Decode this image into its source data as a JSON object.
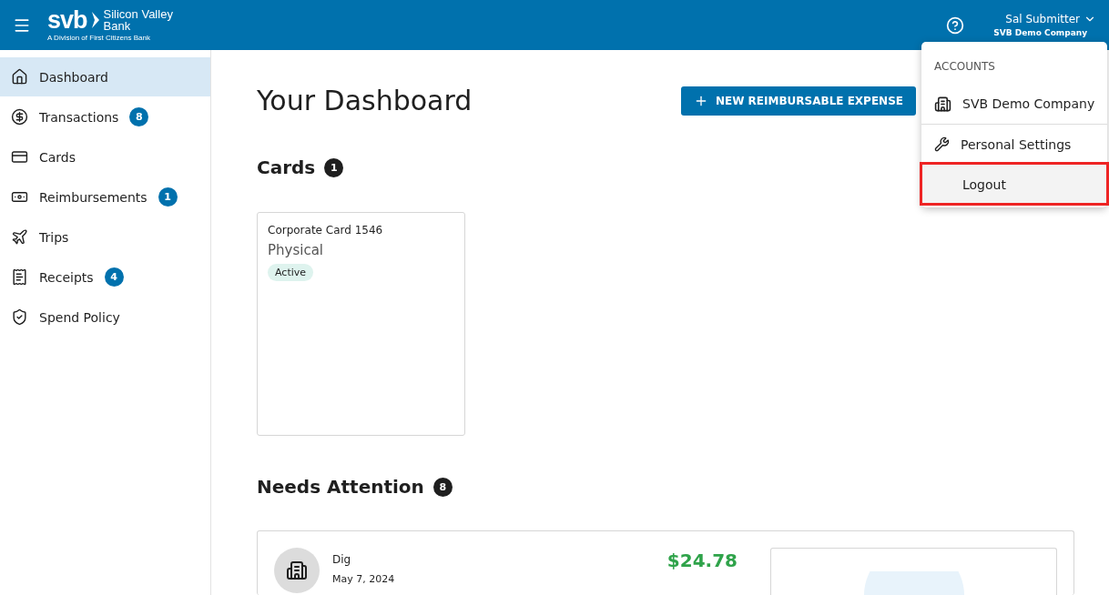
{
  "header": {
    "logo_mark": "svb",
    "logo_name": "Silicon Valley Bank",
    "logo_sub": "A Division of First Citizens Bank",
    "user_name": "Sal Submitter",
    "user_company": "SVB Demo Company"
  },
  "sidebar": {
    "items": [
      {
        "kind": "home",
        "label": "Dashboard",
        "selected": true
      },
      {
        "kind": "dollar",
        "label": "Transactions",
        "badge": "8",
        "selected": false
      },
      {
        "kind": "card",
        "label": "Cards",
        "selected": false
      },
      {
        "kind": "cash",
        "label": "Reimbursements",
        "badge": "1",
        "selected": false
      },
      {
        "kind": "plane",
        "label": "Trips",
        "selected": false
      },
      {
        "kind": "receipt",
        "label": "Receipts",
        "badge": "4",
        "selected": false
      },
      {
        "kind": "shield",
        "label": "Spend Policy",
        "selected": false
      }
    ]
  },
  "main": {
    "title": "Your Dashboard",
    "new_button": "NEW REIMBURSABLE EXPENSE",
    "cards_section": {
      "title": "Cards",
      "count": "1",
      "cards": [
        {
          "name": "Corporate Card 1546",
          "type": "Physical",
          "status": "Active"
        }
      ]
    },
    "attention_section": {
      "title": "Needs Attention",
      "count": "8",
      "items": [
        {
          "merchant": "Dig",
          "date": "May 7, 2024",
          "amount": "$24.78"
        }
      ]
    }
  },
  "account_menu": {
    "heading": "ACCOUNTS",
    "items": [
      {
        "kind": "building",
        "label": "SVB Demo Company",
        "highlighted": false
      },
      {
        "kind": "wrench",
        "label": "Personal Settings",
        "highlighted": false
      },
      {
        "kind": "none",
        "label": "Logout",
        "highlighted": true
      }
    ]
  }
}
